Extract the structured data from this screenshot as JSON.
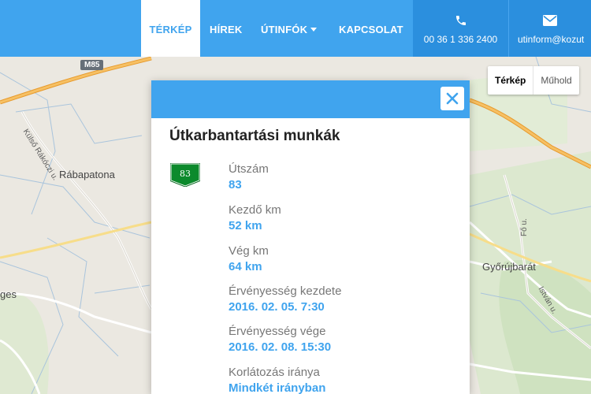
{
  "nav": {
    "items": [
      {
        "label": "TÉRKÉP",
        "active": true
      },
      {
        "label": "HÍREK"
      },
      {
        "label": "ÚTINFÓK",
        "has_dropdown": true
      },
      {
        "label": "KAPCSOLAT"
      }
    ],
    "phone": "00 36 1 336 2400",
    "email": "utinform@kozut"
  },
  "map": {
    "road_shield": "M85",
    "places": [
      "Külső Rákóczi u.",
      "Rábapatona",
      "Győrújbarát",
      "Fő u.",
      "István u.",
      "ges"
    ],
    "map_type_buttons": [
      "Térkép",
      "Műhold"
    ],
    "selected_map_type": "Térkép"
  },
  "panel": {
    "title": "Útkarbantartási munkák",
    "road_badge": "83",
    "fields": [
      {
        "label": "Útszám",
        "value": "83"
      },
      {
        "label": "Kezdő km",
        "value": "52 km"
      },
      {
        "label": "Vég km",
        "value": "64 km"
      },
      {
        "label": "Érvényesség kezdete",
        "value": "2016. 02. 05. 7:30"
      },
      {
        "label": "Érvényesség vége",
        "value": "2016. 02. 08. 15:30"
      },
      {
        "label": "Korlátozás iránya",
        "value": "Mindkét irányban"
      }
    ]
  },
  "colors": {
    "brand": "#40a4ee",
    "contact_bg": "#2b8fde",
    "road_badge": "#0c8a2c",
    "highway": "#f2a93b"
  },
  "icons": {
    "phone": "phone-icon",
    "email": "envelope-icon",
    "close": "close-icon"
  }
}
